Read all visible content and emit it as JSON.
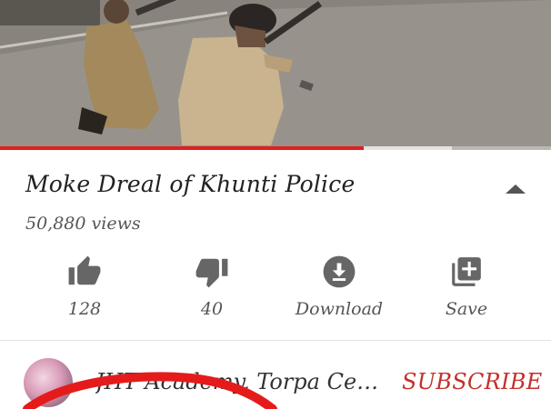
{
  "video": {
    "title": "Moke Dreal of Khunti Police",
    "views": "50,880 views",
    "progress": 0.66,
    "buffered": 0.82
  },
  "actions": [
    {
      "label": "128",
      "icon": "thumbs-up-icon"
    },
    {
      "label": "40",
      "icon": "thumbs-down-icon"
    },
    {
      "label": "Download",
      "icon": "download-icon"
    },
    {
      "label": "Save",
      "icon": "add-to-playlist-icon"
    }
  ],
  "channel": {
    "name": "JHT Academy, Torpa Cent...",
    "subscribe_label": "SUBSCRIBE"
  },
  "colors": {
    "accent_red": "#c4302b",
    "progress_red": "#e02020",
    "icon_gray": "#666666",
    "annotation_red": "#e51b1b"
  }
}
